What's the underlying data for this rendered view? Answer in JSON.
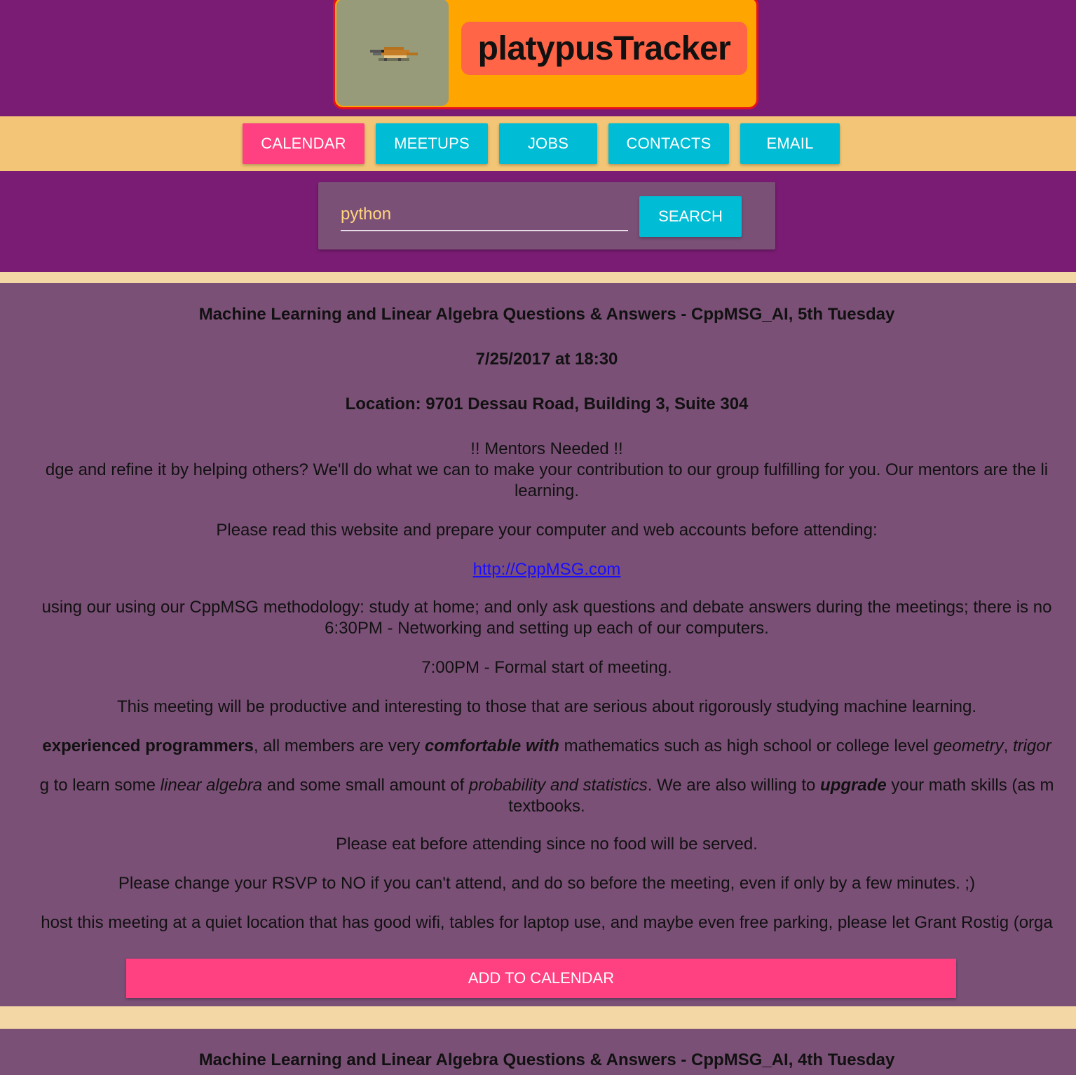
{
  "header": {
    "logo_icon": "platypus-pixel-icon",
    "title": "platypusTracker"
  },
  "nav": {
    "items": [
      {
        "label": "CALENDAR",
        "active": true
      },
      {
        "label": "MEETUPS",
        "active": false
      },
      {
        "label": "JOBS",
        "active": false
      },
      {
        "label": "CONTACTS",
        "active": false
      },
      {
        "label": "EMAIL",
        "active": false
      }
    ]
  },
  "search": {
    "value": "python",
    "button_label": "SEARCH"
  },
  "events": [
    {
      "title": "Machine Learning and Linear Algebra Questions & Answers - CppMSG_AI, 5th Tuesday",
      "datetime": "7/25/2017 at 18:30",
      "location": "Location: 9701 Dessau Road, Building 3, Suite 304",
      "description": {
        "mentors_heading": "!! Mentors Needed !!",
        "mentors_line1": "dge and refine it by helping others?  We'll do what we can to make your contribution to our group fulfilling for you.  Our mentors are the li",
        "mentors_line2": "learning.",
        "read_website": "Please read this website and prepare your computer and web accounts before attending:",
        "link": "http://CppMSG.com",
        "methodology_line1": " using our using our CppMSG methodology: study at home; and only ask questions and debate answers during the meetings; there is no",
        "methodology_line2": "6:30PM - Networking and setting up each of our computers.",
        "start_time": "7:00PM - Formal start of meeting.",
        "productive": "This meeting will be productive and interesting to those that are serious about rigorously studying machine learning.",
        "experienced": {
          "p1": "experienced programmers",
          "p2": ", all members are very ",
          "p3": "comfortable with",
          "p4": " mathematics such as high school or college level ",
          "p5": "geometry",
          "p6": ", ",
          "p7": "trigor"
        },
        "learn": {
          "p1": "g to learn some ",
          "p2": "linear algebra",
          "p3": " and some small amount of ",
          "p4": "probability and statistics",
          "p5": ". We are also willing to ",
          "p6": "upgrade",
          "p7": " your math skills (as m",
          "line2": "textbooks."
        },
        "food": "Please eat before attending since no food will be served.",
        "rsvp": "Please change your RSVP to NO if you can't attend, and do so before the meeting, even if only by a few minutes. ;)",
        "host": "host this meeting at a quiet location that has good wifi, tables for laptop use, and maybe even free parking, please let Grant Rostig (orga"
      },
      "add_button_label": "ADD TO CALENDAR"
    },
    {
      "title": "Machine Learning and Linear Algebra Questions & Answers - CppMSG_AI, 4th Tuesday"
    }
  ]
}
